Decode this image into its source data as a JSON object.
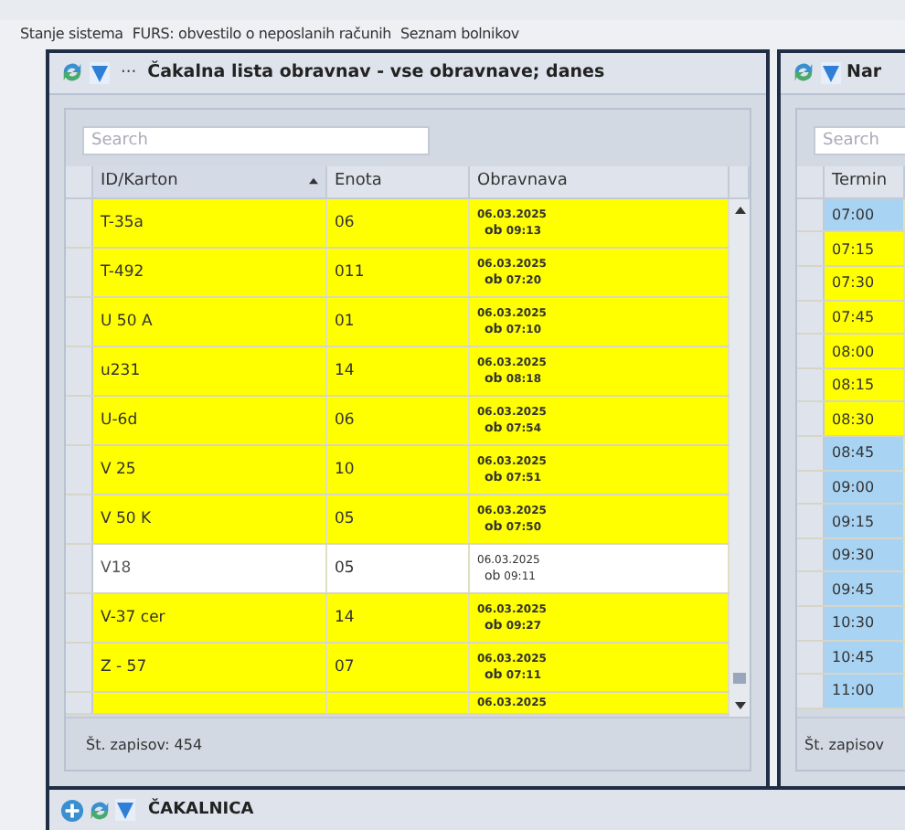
{
  "menu": [
    "Stanje sistema",
    "FURS: obvestilo o neposlanih računih",
    "Seznam bolnikov"
  ],
  "left_panel": {
    "more": "···",
    "title": "Čakalna lista obravnav - vse obravnave; danes",
    "search": {
      "placeholder": "Search"
    },
    "columns": [
      {
        "label": "ID/Karton",
        "sorted": true
      },
      {
        "label": "Enota",
        "sorted": false
      },
      {
        "label": "Obravnava",
        "sorted": false
      }
    ],
    "rows": [
      {
        "id": "T-35a",
        "unit": "06",
        "date": "06.03.2025",
        "prefix": "ob",
        "time": "09:13",
        "highlighted": true
      },
      {
        "id": "T-492",
        "unit": "011",
        "date": "06.03.2025",
        "prefix": "ob",
        "time": "07:20",
        "highlighted": true
      },
      {
        "id": "U 50 A",
        "unit": "01",
        "date": "06.03.2025",
        "prefix": "ob",
        "time": "07:10",
        "highlighted": true
      },
      {
        "id": "u231",
        "unit": "14",
        "date": "06.03.2025",
        "prefix": "ob",
        "time": "08:18",
        "highlighted": true
      },
      {
        "id": "U-6d",
        "unit": "06",
        "date": "06.03.2025",
        "prefix": "ob",
        "time": "07:54",
        "highlighted": true
      },
      {
        "id": "V 25",
        "unit": "10",
        "date": "06.03.2025",
        "prefix": "ob",
        "time": "07:51",
        "highlighted": true
      },
      {
        "id": "V 50 K",
        "unit": "05",
        "date": "06.03.2025",
        "prefix": "ob",
        "time": "07:50",
        "highlighted": true
      },
      {
        "id": "V18",
        "unit": "05",
        "date": "06.03.2025",
        "prefix": "ob",
        "time": "09:11",
        "highlighted": false
      },
      {
        "id": "V-37 cer",
        "unit": "14",
        "date": "06.03.2025",
        "prefix": "ob",
        "time": "09:27",
        "highlighted": true
      },
      {
        "id": "Z - 57",
        "unit": "07",
        "date": "06.03.2025",
        "prefix": "ob",
        "time": "07:11",
        "highlighted": true
      },
      {
        "date": "06.03.2025",
        "highlighted": true
      }
    ],
    "footer": "Št. zapisov: 454"
  },
  "right_panel": {
    "title": "Nar",
    "search": {
      "placeholder": "Search"
    },
    "columns": [
      "Termin"
    ],
    "rows": [
      {
        "time": "07:00",
        "highlighted": false
      },
      {
        "time": "07:15",
        "highlighted": true
      },
      {
        "time": "07:30",
        "highlighted": true
      },
      {
        "time": "07:45",
        "highlighted": true
      },
      {
        "time": "08:00",
        "highlighted": true
      },
      {
        "time": "08:15",
        "highlighted": true
      },
      {
        "time": "08:30",
        "highlighted": true
      },
      {
        "time": "08:45",
        "highlighted": false
      },
      {
        "time": "09:00",
        "highlighted": false
      },
      {
        "time": "09:15",
        "highlighted": false
      },
      {
        "time": "09:30",
        "highlighted": false
      },
      {
        "time": "09:45",
        "highlighted": false
      },
      {
        "time": "10:30",
        "highlighted": false
      },
      {
        "time": "10:45",
        "highlighted": false
      },
      {
        "time": "11:00",
        "highlighted": false
      }
    ],
    "footer": "Št. zapisov"
  },
  "bottom_panel": {
    "title": "ČAKALNICA"
  }
}
